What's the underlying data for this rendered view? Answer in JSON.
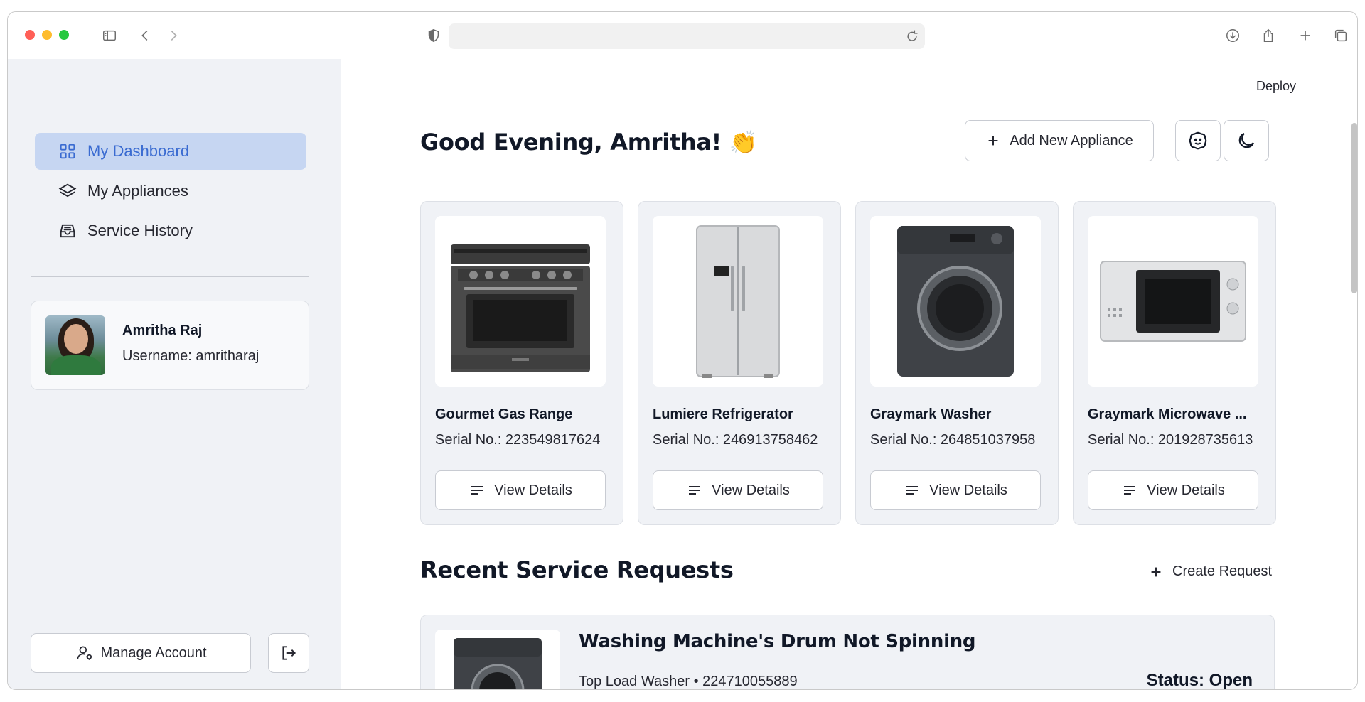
{
  "browser": {
    "address": ""
  },
  "sidebar": {
    "items": [
      {
        "label": "My Dashboard",
        "icon": "grid-icon",
        "active": true
      },
      {
        "label": "My Appliances",
        "icon": "layers-icon",
        "active": false
      },
      {
        "label": "Service History",
        "icon": "inbox-icon",
        "active": false
      }
    ],
    "profile": {
      "name": "Amritha Raj",
      "username": "Username: amritharaj"
    },
    "manage_label": "Manage Account"
  },
  "main": {
    "deploy_label": "Deploy",
    "greeting": "Good Evening, Amritha! 👏",
    "add_appliance_label": "Add New Appliance",
    "appliances": [
      {
        "name": "Gourmet Gas Range",
        "serial": "Serial No.: 223549817624",
        "view_label": "View Details",
        "image": "gas-range"
      },
      {
        "name": "Lumiere Refrigerator",
        "serial": "Serial No.: 246913758462",
        "view_label": "View Details",
        "image": "refrigerator"
      },
      {
        "name": "Graymark Washer",
        "serial": "Serial No.: 264851037958",
        "view_label": "View Details",
        "image": "washer"
      },
      {
        "name": "Graymark Microwave ...",
        "serial": "Serial No.: 201928735613",
        "view_label": "View Details",
        "image": "microwave"
      }
    ],
    "recent_title": "Recent Service Requests",
    "create_request_label": "Create Request",
    "requests": [
      {
        "title": "Washing Machine's Drum Not Spinning",
        "meta": "Top Load Washer • 224710055889",
        "status": "Status: Open"
      }
    ]
  },
  "colors": {
    "sidebar_bg": "#f0f2f6",
    "active_nav_bg": "#c6d6f2",
    "active_nav_text": "#3a6bd1"
  }
}
